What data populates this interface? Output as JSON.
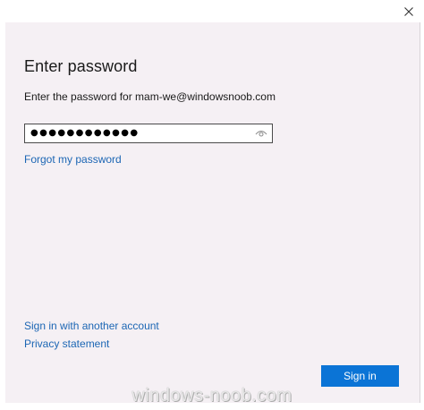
{
  "window": {
    "close_icon": "close-icon"
  },
  "dialog": {
    "heading": "Enter password",
    "instruction": "Enter the password for mam-we@windowsnoob.com",
    "password_value": "●●●●●●●●●●●●",
    "reveal_icon": "eye-icon",
    "forgot_link": "Forgot my password",
    "another_account_link": "Sign in with another account",
    "privacy_link": "Privacy statement",
    "signin_label": "Sign in"
  },
  "watermark": "windows-noob.com",
  "colors": {
    "panel_bg": "#f5f0f4",
    "link": "#1c66b4",
    "accent_button": "#0b74d6"
  }
}
